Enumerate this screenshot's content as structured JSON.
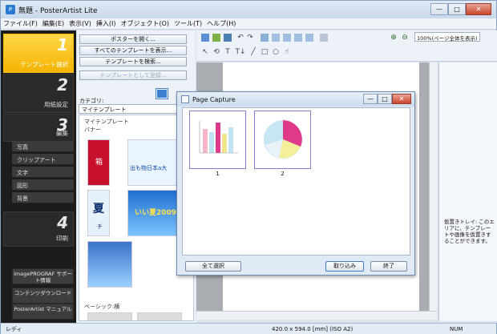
{
  "window": {
    "title": "無題 - PosterArtist Lite",
    "app_icon": "P",
    "minimize": "—",
    "maximize": "□",
    "close": "✕"
  },
  "menu": [
    "ファイル(F)",
    "編集(E)",
    "表示(V)",
    "挿入(I)",
    "オブジェクト(O)",
    "ツール(T)",
    "ヘルプ(H)"
  ],
  "steps": [
    {
      "num": "1",
      "label": "テンプレート選択"
    },
    {
      "num": "2",
      "label": "用紙設定"
    },
    {
      "num": "3",
      "label": "編集"
    },
    {
      "num": "4",
      "label": "印刷"
    }
  ],
  "edit_items": [
    "写真",
    "クリップアート",
    "文字",
    "図形",
    "背景"
  ],
  "bottom_buttons": [
    "imagePROGRAF サポート情報",
    "コンテンツダウンロード",
    "PosterArtist マニュアル"
  ],
  "panel": {
    "buttons": [
      "ポスターを開く...",
      "すべてのテンプレートを表示...",
      "テンプレートを検索...",
      "テンプレートとして登録..."
    ],
    "category_label": "カテゴリ:",
    "category_value": "マイテンプレート",
    "tree_root": "マイテンプレート",
    "tree_child": "バナー",
    "tree_basic": "ベーシック:横",
    "thumb_text": {
      "hakone": "箱",
      "goods": "出も物日本a大",
      "natsu": "夏",
      "natsu_sub": "チ",
      "summer": "いい夏2009"
    }
  },
  "toolbar": {
    "zoom": "100%(ページ全体を表示)",
    "icons": {
      "undo": "↶",
      "redo": "↷",
      "text": "T",
      "vtext": "T↓",
      "line": "╱",
      "rect": "□",
      "ellipse": "○",
      "hand": "☝",
      "zoom_in": "⊕",
      "zoom_out": "⊖",
      "pointer": "↖",
      "rotate": "⟲"
    }
  },
  "tray": {
    "text": "仮置きトレイ: このエリアに、テンプレートや画像を仮置きすることができます。"
  },
  "status": {
    "left": "レディ",
    "center": "420.0 x 594.0 [mm] (ISO A2)",
    "right": "NUM"
  },
  "dialog": {
    "title": "Page Capture",
    "captures": [
      {
        "num": "1"
      },
      {
        "num": "2"
      }
    ],
    "select_all": "全て選択",
    "import": "取り込み",
    "close": "終了"
  },
  "colors": {
    "accent_yellow": "#f4b400",
    "nav_dark": "#1c1c1c",
    "capture_border": "#8a7fd6"
  }
}
